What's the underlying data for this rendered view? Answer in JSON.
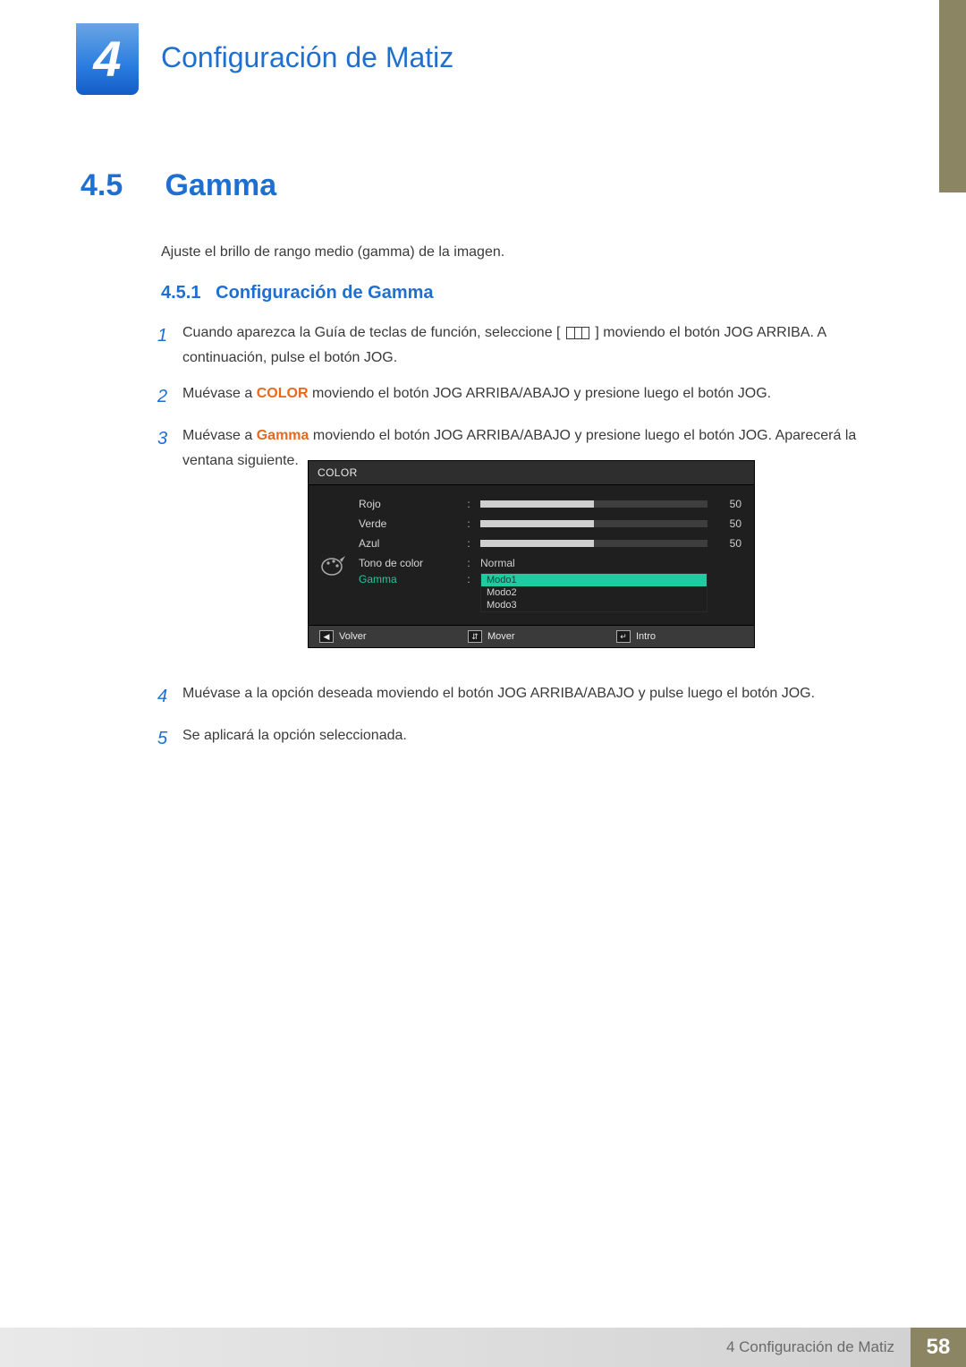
{
  "chapter": {
    "number": "4",
    "title": "Configuración de Matiz"
  },
  "section": {
    "num": "4.5",
    "title": "Gamma"
  },
  "intro": "Ajuste el brillo de rango medio (gamma) de la imagen.",
  "subsection": {
    "num": "4.5.1",
    "title": "Configuración de Gamma"
  },
  "steps": {
    "s1": {
      "n": "1",
      "a": "Cuando aparezca la Guía de teclas de función, seleccione [",
      "b": "] moviendo el botón JOG ARRIBA. A continuación, pulse el botón JOG."
    },
    "s2": {
      "n": "2",
      "a": "Muévase a ",
      "hl": "COLOR",
      "b": " moviendo el botón JOG ARRIBA/ABAJO y presione luego el botón JOG."
    },
    "s3": {
      "n": "3",
      "a": "Muévase a ",
      "hl": "Gamma",
      "b": " moviendo el botón JOG ARRIBA/ABAJO y presione luego el botón JOG. Aparecerá la ventana siguiente."
    },
    "s4": {
      "n": "4",
      "t": "Muévase a la opción deseada moviendo el botón JOG ARRIBA/ABAJO y pulse luego el botón JOG."
    },
    "s5": {
      "n": "5",
      "t": "Se aplicará la opción seleccionada."
    }
  },
  "osd": {
    "title": "COLOR",
    "rows": {
      "rojo": {
        "label": "Rojo",
        "value": "50",
        "pct": 50
      },
      "verde": {
        "label": "Verde",
        "value": "50",
        "pct": 50
      },
      "azul": {
        "label": "Azul",
        "value": "50",
        "pct": 50
      },
      "tono": {
        "label": "Tono de color",
        "value": "Normal"
      },
      "gamma": {
        "label": "Gamma",
        "options": {
          "o1": "Modo1",
          "o2": "Modo2",
          "o3": "Modo3"
        }
      }
    },
    "footer": {
      "back": "Volver",
      "move": "Mover",
      "enter": "Intro"
    }
  },
  "footer": {
    "text": "4 Configuración de Matiz",
    "page": "58"
  }
}
